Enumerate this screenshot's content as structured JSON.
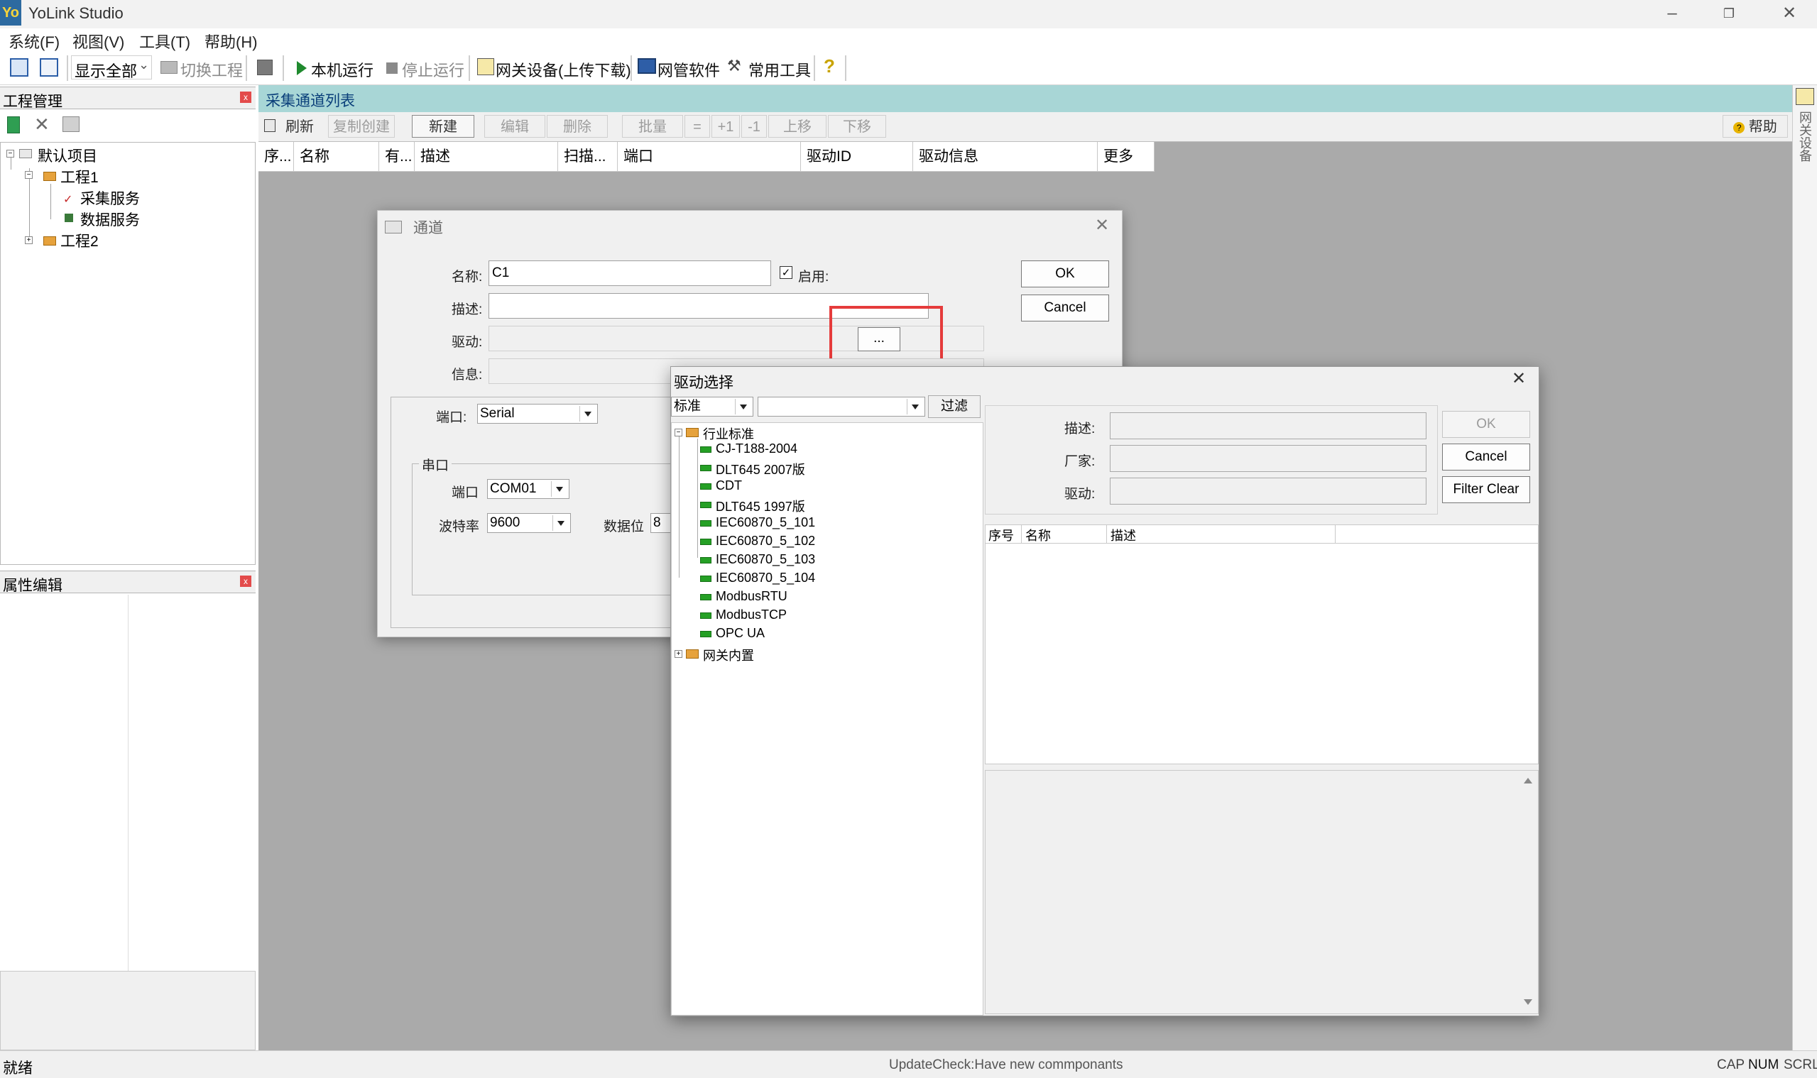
{
  "app": {
    "icon_text": "Yo",
    "title": "YoLink Studio"
  },
  "menu": [
    "系统(F)",
    "视图(V)",
    "工具(T)",
    "帮助(H)"
  ],
  "toolbar": {
    "view_combo": "显示全部",
    "switch_project": "切换工程",
    "run_local": "本机运行",
    "stop_run": "停止运行",
    "gateway_device": "网关设备(上传下载)",
    "net_software": "网管软件",
    "common_tools": "常用工具"
  },
  "project_panel": {
    "title": "工程管理",
    "close": "x",
    "tree": {
      "root": "默认项目",
      "project1": "工程1",
      "collect_service": "采集服务",
      "data_service": "数据服务",
      "project2": "工程2"
    }
  },
  "property_panel": {
    "title": "属性编辑",
    "close": "x"
  },
  "main": {
    "header_title": "采集通道列表",
    "buttons": [
      "刷新",
      "复制创建",
      "新建",
      "编辑",
      "删除",
      "批量",
      "=",
      "+1",
      "-1",
      "上移",
      "下移"
    ],
    "help": "帮助",
    "columns": [
      "序...",
      "名称",
      "有...",
      "描述",
      "扫描...",
      "端口",
      "驱动ID",
      "驱动信息",
      "更多"
    ]
  },
  "right_strip": {
    "label": "网关设备"
  },
  "channel_dialog": {
    "title": "通道",
    "name_label": "名称:",
    "name_value": "C1",
    "enable_label": "启用:",
    "enable_checked": true,
    "desc_label": "描述:",
    "driver_label": "驱动:",
    "browse": "...",
    "info_label": "信息:",
    "ok": "OK",
    "cancel": "Cancel",
    "port_label": "端口:",
    "port_value": "Serial",
    "serial_group": "串口",
    "serial_port_label": "端口",
    "serial_port_value": "COM01",
    "baud_label": "波特率",
    "baud_value": "9600",
    "databits_label": "数据位",
    "databits_value": "8"
  },
  "driver_dialog": {
    "title": "驱动选择",
    "filter_combo": "标准",
    "filter_text": "",
    "filter_button": "过滤",
    "tree": {
      "group1": "行业标准",
      "items": [
        "CJ-T188-2004",
        "DLT645 2007版",
        "CDT",
        "DLT645 1997版",
        "IEC60870_5_101",
        "IEC60870_5_102",
        "IEC60870_5_103",
        "IEC60870_5_104",
        "ModbusRTU",
        "ModbusTCP",
        "OPC UA"
      ],
      "group2": "网关内置"
    },
    "desc_label": "描述:",
    "vendor_label": "厂家:",
    "driver_label": "驱动:",
    "ok": "OK",
    "cancel": "Cancel",
    "filter_clear": "Filter Clear",
    "columns": [
      "序号",
      "名称",
      "描述"
    ]
  },
  "status": {
    "left": "就绪",
    "center": "UpdateCheck:Have new commponants",
    "cap": "CAP",
    "num": "NUM",
    "scrl": "SCRL"
  },
  "colors": {
    "accent_red": "#e53b3b",
    "header_teal": "#a8d6d6",
    "workspace_gray": "#aaaaaa"
  }
}
